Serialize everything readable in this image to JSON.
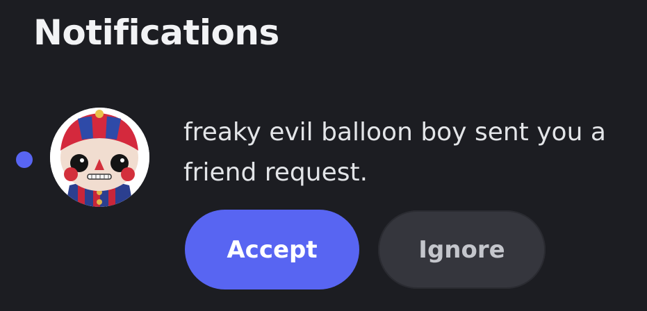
{
  "header": {
    "title": "Notifications"
  },
  "notification": {
    "unread": true,
    "avatar_icon": "balloon-boy-figure-avatar",
    "message": "freaky evil balloon boy sent you a friend request.",
    "actions": {
      "accept_label": "Accept",
      "ignore_label": "Ignore"
    }
  },
  "colors": {
    "background": "#1c1d22",
    "accent": "#5865f2",
    "ignore_button": "#35363d",
    "unread_dot": "#5865f2"
  }
}
